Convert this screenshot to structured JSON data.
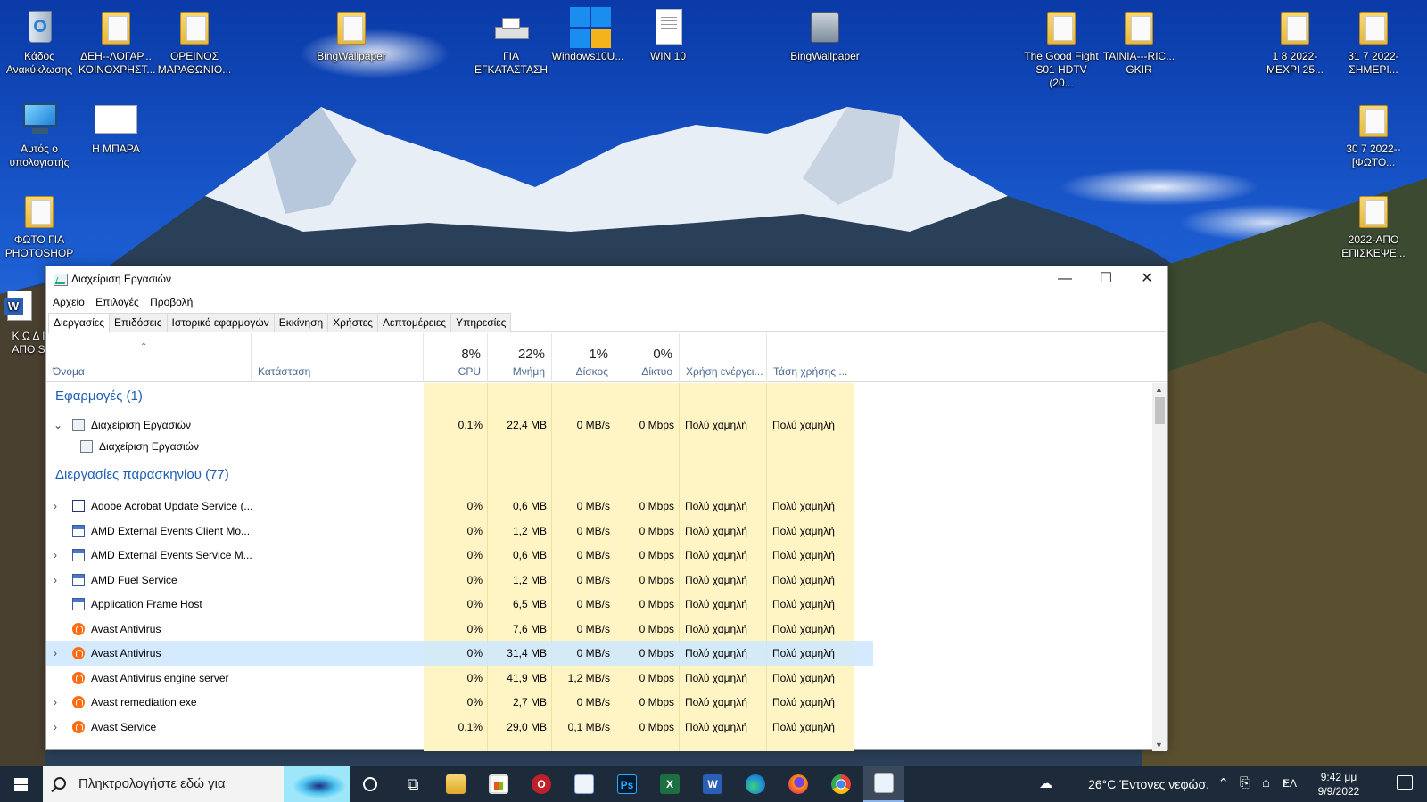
{
  "desktop": {
    "icons": [
      {
        "label": "Κάδος Ανακύκλωσης",
        "icon": "recycle-bin-icon"
      },
      {
        "label": "ΔΕΗ--ΛΟΓΑΡ... ΚΟΙΝΟΧΡΗΣΤ...",
        "icon": "folder-icon"
      },
      {
        "label": "ΟΡΕΙΝΟΣ ΜΑΡΑΘΩΝΙΟ...",
        "icon": "folder-icon"
      },
      {
        "label": "BingWallpaper",
        "icon": "folder-icon"
      },
      {
        "label": "ΓΙΑ ΕΓΚΑΤΑΣΤΑΣΗ",
        "icon": "installer-icon"
      },
      {
        "label": "Windows10U...",
        "icon": "windows-update-icon"
      },
      {
        "label": "WIN 10",
        "icon": "document-icon"
      },
      {
        "label": "BingWallpaper",
        "icon": "app-icon"
      },
      {
        "label": "The Good Fight S01 HDTV (20...",
        "icon": "folder-icon"
      },
      {
        "label": "TAINIA---RIC... GKIR",
        "icon": "folder-icon"
      },
      {
        "label": "1 8 2022-ΜΕΧΡΙ 25...",
        "icon": "folder-icon"
      },
      {
        "label": "31 7 2022-ΣΗΜΕΡΙ...",
        "icon": "folder-icon"
      },
      {
        "label": "Αυτός ο υπολογιστής",
        "icon": "this-pc-icon"
      },
      {
        "label": "Η ΜΠΑΡΑ",
        "icon": "document-icon"
      },
      {
        "label": "30 7 2022--[ΦΩΤΟ...",
        "icon": "folder-icon"
      },
      {
        "label": "ΦΩΤΟ ΓΙΑ PHOTOSHOP",
        "icon": "folder-icon"
      },
      {
        "label": "2022-ΑΠΟ ΕΠΙΣΚΕΨΕ...",
        "icon": "folder-icon"
      },
      {
        "label": "Κ Ω Δ Ι ΑΠΟ S",
        "icon": "word-doc-icon"
      }
    ]
  },
  "taskmanager": {
    "title": "Διαχείριση Εργασιών",
    "menu": [
      "Αρχείο",
      "Επιλογές",
      "Προβολή"
    ],
    "tabs": [
      "Διεργασίες",
      "Επιδόσεις",
      "Ιστορικό εφαρμογών",
      "Εκκίνηση",
      "Χρήστες",
      "Λεπτομέρειες",
      "Υπηρεσίες"
    ],
    "active_tab": "Διεργασίες",
    "columns": {
      "name": "Όνομα",
      "status": "Κατάσταση",
      "cpu": {
        "pct": "8%",
        "label": "CPU"
      },
      "memory": {
        "pct": "22%",
        "label": "Μνήμη"
      },
      "disk": {
        "pct": "1%",
        "label": "Δίσκος"
      },
      "network": {
        "pct": "0%",
        "label": "Δίκτυο"
      },
      "power": "Χρήση ενέργει...",
      "power_trend": "Τάση χρήσης ..."
    },
    "groups": {
      "apps": "Εφαρμογές (1)",
      "background": "Διεργασίες παρασκηνίου (77)"
    },
    "app_rows": [
      {
        "name": "Διαχείριση Εργασιών",
        "cpu": "0,1%",
        "mem": "22,4 MB",
        "disk": "0 MB/s",
        "net": "0 Mbps",
        "power": "Πολύ χαμηλή",
        "trend": "Πολύ χαμηλή",
        "expanded": true
      },
      {
        "name": "Διαχείριση Εργασιών"
      }
    ],
    "bg_rows": [
      {
        "name": "Adobe Acrobat Update Service (...",
        "icon": "acrobat-update-icon",
        "expandable": true,
        "cpu": "0%",
        "mem": "0,6 MB",
        "disk": "0 MB/s",
        "net": "0 Mbps",
        "power": "Πολύ χαμηλή",
        "trend": "Πολύ χαμηλή"
      },
      {
        "name": "AMD External Events Client Mo...",
        "icon": "amd-service-icon",
        "expandable": false,
        "cpu": "0%",
        "mem": "1,2 MB",
        "disk": "0 MB/s",
        "net": "0 Mbps",
        "power": "Πολύ χαμηλή",
        "trend": "Πολύ χαμηλή"
      },
      {
        "name": "AMD External Events Service M...",
        "icon": "amd-service-icon",
        "expandable": true,
        "cpu": "0%",
        "mem": "0,6 MB",
        "disk": "0 MB/s",
        "net": "0 Mbps",
        "power": "Πολύ χαμηλή",
        "trend": "Πολύ χαμηλή"
      },
      {
        "name": "AMD Fuel Service",
        "icon": "amd-service-icon",
        "expandable": true,
        "cpu": "0%",
        "mem": "1,2 MB",
        "disk": "0 MB/s",
        "net": "0 Mbps",
        "power": "Πολύ χαμηλή",
        "trend": "Πολύ χαμηλή"
      },
      {
        "name": "Application Frame Host",
        "icon": "amd-service-icon",
        "expandable": false,
        "cpu": "0%",
        "mem": "6,5 MB",
        "disk": "0 MB/s",
        "net": "0 Mbps",
        "power": "Πολύ χαμηλή",
        "trend": "Πολύ χαμηλή"
      },
      {
        "name": "Avast Antivirus",
        "icon": "avast-icon",
        "expandable": false,
        "cpu": "0%",
        "mem": "7,6 MB",
        "disk": "0 MB/s",
        "net": "0 Mbps",
        "power": "Πολύ χαμηλή",
        "trend": "Πολύ χαμηλή"
      },
      {
        "name": "Avast Antivirus",
        "icon": "avast-icon",
        "expandable": true,
        "selected": true,
        "cpu": "0%",
        "mem": "31,4 MB",
        "disk": "0 MB/s",
        "net": "0 Mbps",
        "power": "Πολύ χαμηλή",
        "trend": "Πολύ χαμηλή"
      },
      {
        "name": "Avast Antivirus engine server",
        "icon": "avast-icon",
        "expandable": false,
        "cpu": "0%",
        "mem": "41,9 MB",
        "disk": "1,2 MB/s",
        "net": "0 Mbps",
        "power": "Πολύ χαμηλή",
        "trend": "Πολύ χαμηλή"
      },
      {
        "name": "Avast remediation exe",
        "icon": "avast-icon",
        "expandable": true,
        "cpu": "0%",
        "mem": "2,7 MB",
        "disk": "0 MB/s",
        "net": "0 Mbps",
        "power": "Πολύ χαμηλή",
        "trend": "Πολύ χαμηλή"
      },
      {
        "name": "Avast Service",
        "icon": "avast-icon",
        "expandable": true,
        "cpu": "0,1%",
        "mem": "29,0 MB",
        "disk": "0,1 MB/s",
        "net": "0 Mbps",
        "power": "Πολύ χαμηλή",
        "trend": "Πολύ χαμηλή"
      }
    ]
  },
  "taskbar": {
    "search_placeholder": "Πληκτρολογήστε εδώ για",
    "weather": "26°C  Έντονες νεφώσ.",
    "language": "ΕΛ",
    "time": "9:42 μμ",
    "date": "9/9/2022",
    "apps": [
      {
        "name": "task-view-icon",
        "label": "○"
      },
      {
        "name": "taskview-timeline-icon",
        "label": "⧉"
      },
      {
        "name": "file-explorer-icon",
        "label": ""
      },
      {
        "name": "store-icon",
        "label": ""
      },
      {
        "name": "opera-icon",
        "label": "O"
      },
      {
        "name": "outlook-icon",
        "label": ""
      },
      {
        "name": "photoshop-icon",
        "label": "Ps"
      },
      {
        "name": "excel-icon",
        "label": "X"
      },
      {
        "name": "word-icon",
        "label": "W"
      },
      {
        "name": "edge-icon",
        "label": ""
      },
      {
        "name": "firefox-icon",
        "label": ""
      },
      {
        "name": "chrome-icon",
        "label": ""
      },
      {
        "name": "task-manager-icon",
        "label": ""
      }
    ],
    "colors": {
      "taskbar_bg": "#1c2a3a",
      "heat": "#fff4c4",
      "selection": "#cce8ff",
      "group_title": "#1f5fb4"
    }
  }
}
